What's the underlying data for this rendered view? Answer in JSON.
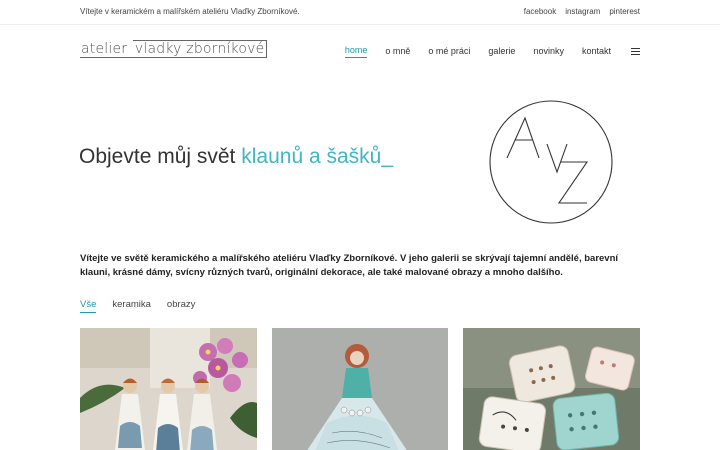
{
  "topbar": {
    "welcome": "Vítejte v keramickém a malířském ateliéru Vlaďky Zborníkové.",
    "social": [
      "facebook",
      "instagram",
      "pinterest"
    ]
  },
  "logo": {
    "part1": "atelier ",
    "part2": "vladky zborníkové"
  },
  "nav": {
    "items": [
      "home",
      "o mně",
      "o mé práci",
      "galerie",
      "novinky",
      "kontakt"
    ],
    "active": "home",
    "menu_icon": "hamburger-menu-icon"
  },
  "hero": {
    "title_plain": "Objevte můj svět ",
    "title_accent": "klaunů a šašků",
    "cursor": "_",
    "accent_color": "#40b6c4",
    "monogram_letters": "AVZ"
  },
  "intro": "Vítejte ve světě keramického a malířského ateliéru Vlaďky Zborníkové. V jeho galerii se skrývají tajemní andělé, barevní klauni, krásné dámy, svícny různých tvarů, originální dekorace, ale také malované obrazy a mnoho dalšího.",
  "filters": {
    "items": [
      "Vše",
      "keramika",
      "obrazy"
    ],
    "active": "Vše"
  },
  "gallery": [
    {
      "name": "ceramic angels with orchids"
    },
    {
      "name": "ceramic lady figure on blue"
    },
    {
      "name": "ceramic soap dishes"
    }
  ]
}
